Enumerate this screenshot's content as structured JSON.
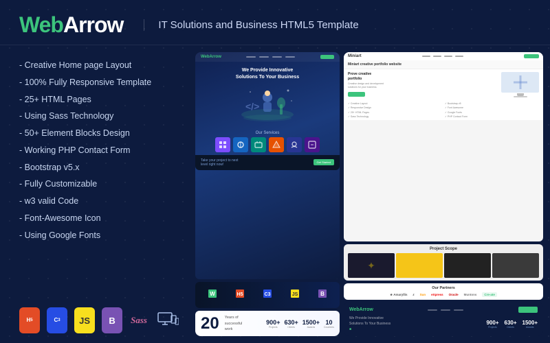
{
  "header": {
    "logo_web": "Web",
    "logo_arrow": "Arrow",
    "tagline": "IT Solutions and Business HTML5 Template"
  },
  "features": {
    "items": [
      "- Creative Home page Layout",
      "- 100% Fully Responsive Template",
      "- 25+ HTML Pages",
      "- Using Sass Technology",
      "- 50+ Element Blocks Design",
      "- Working PHP Contact Form",
      "- Bootstrap v5.x",
      "- Fully Customizable",
      "- w3 valid Code",
      "- Font-Awesome Icon",
      "- Using Google Fonts"
    ]
  },
  "tech_badges": {
    "html": "5",
    "css": "3",
    "js": "JS",
    "bootstrap": "B",
    "sass": "Sass"
  },
  "mock_dark": {
    "nav_logo": "WebArrow",
    "hero_title": "We Provide Innovative\nSolutions To Your Business",
    "services_title": "Our Services",
    "bottom_text": "Take your project to next\nlevel right now!",
    "btn_label": "Get Started"
  },
  "mock_light": {
    "title": "Miniart creative portfolio website",
    "section_project": "Project Scope",
    "section_partners": "Our Partners",
    "partners": [
      "Amaryllis",
      "Oracle",
      "Muntons",
      "Cre-ate",
      "eXpress"
    ],
    "bottom_logo": "WebArrow",
    "btn_label": "Get Started"
  },
  "stats": {
    "items": [
      {
        "num": "20",
        "label": "Years of successful work"
      },
      {
        "num": "900+",
        "label": ""
      },
      {
        "num": "630+",
        "label": ""
      },
      {
        "num": "1500+",
        "label": ""
      },
      {
        "num": "10",
        "label": ""
      }
    ]
  },
  "colors": {
    "accent_green": "#3cc47c",
    "bg_dark": "#0d1b3e",
    "text_light": "#c8d6f0"
  }
}
